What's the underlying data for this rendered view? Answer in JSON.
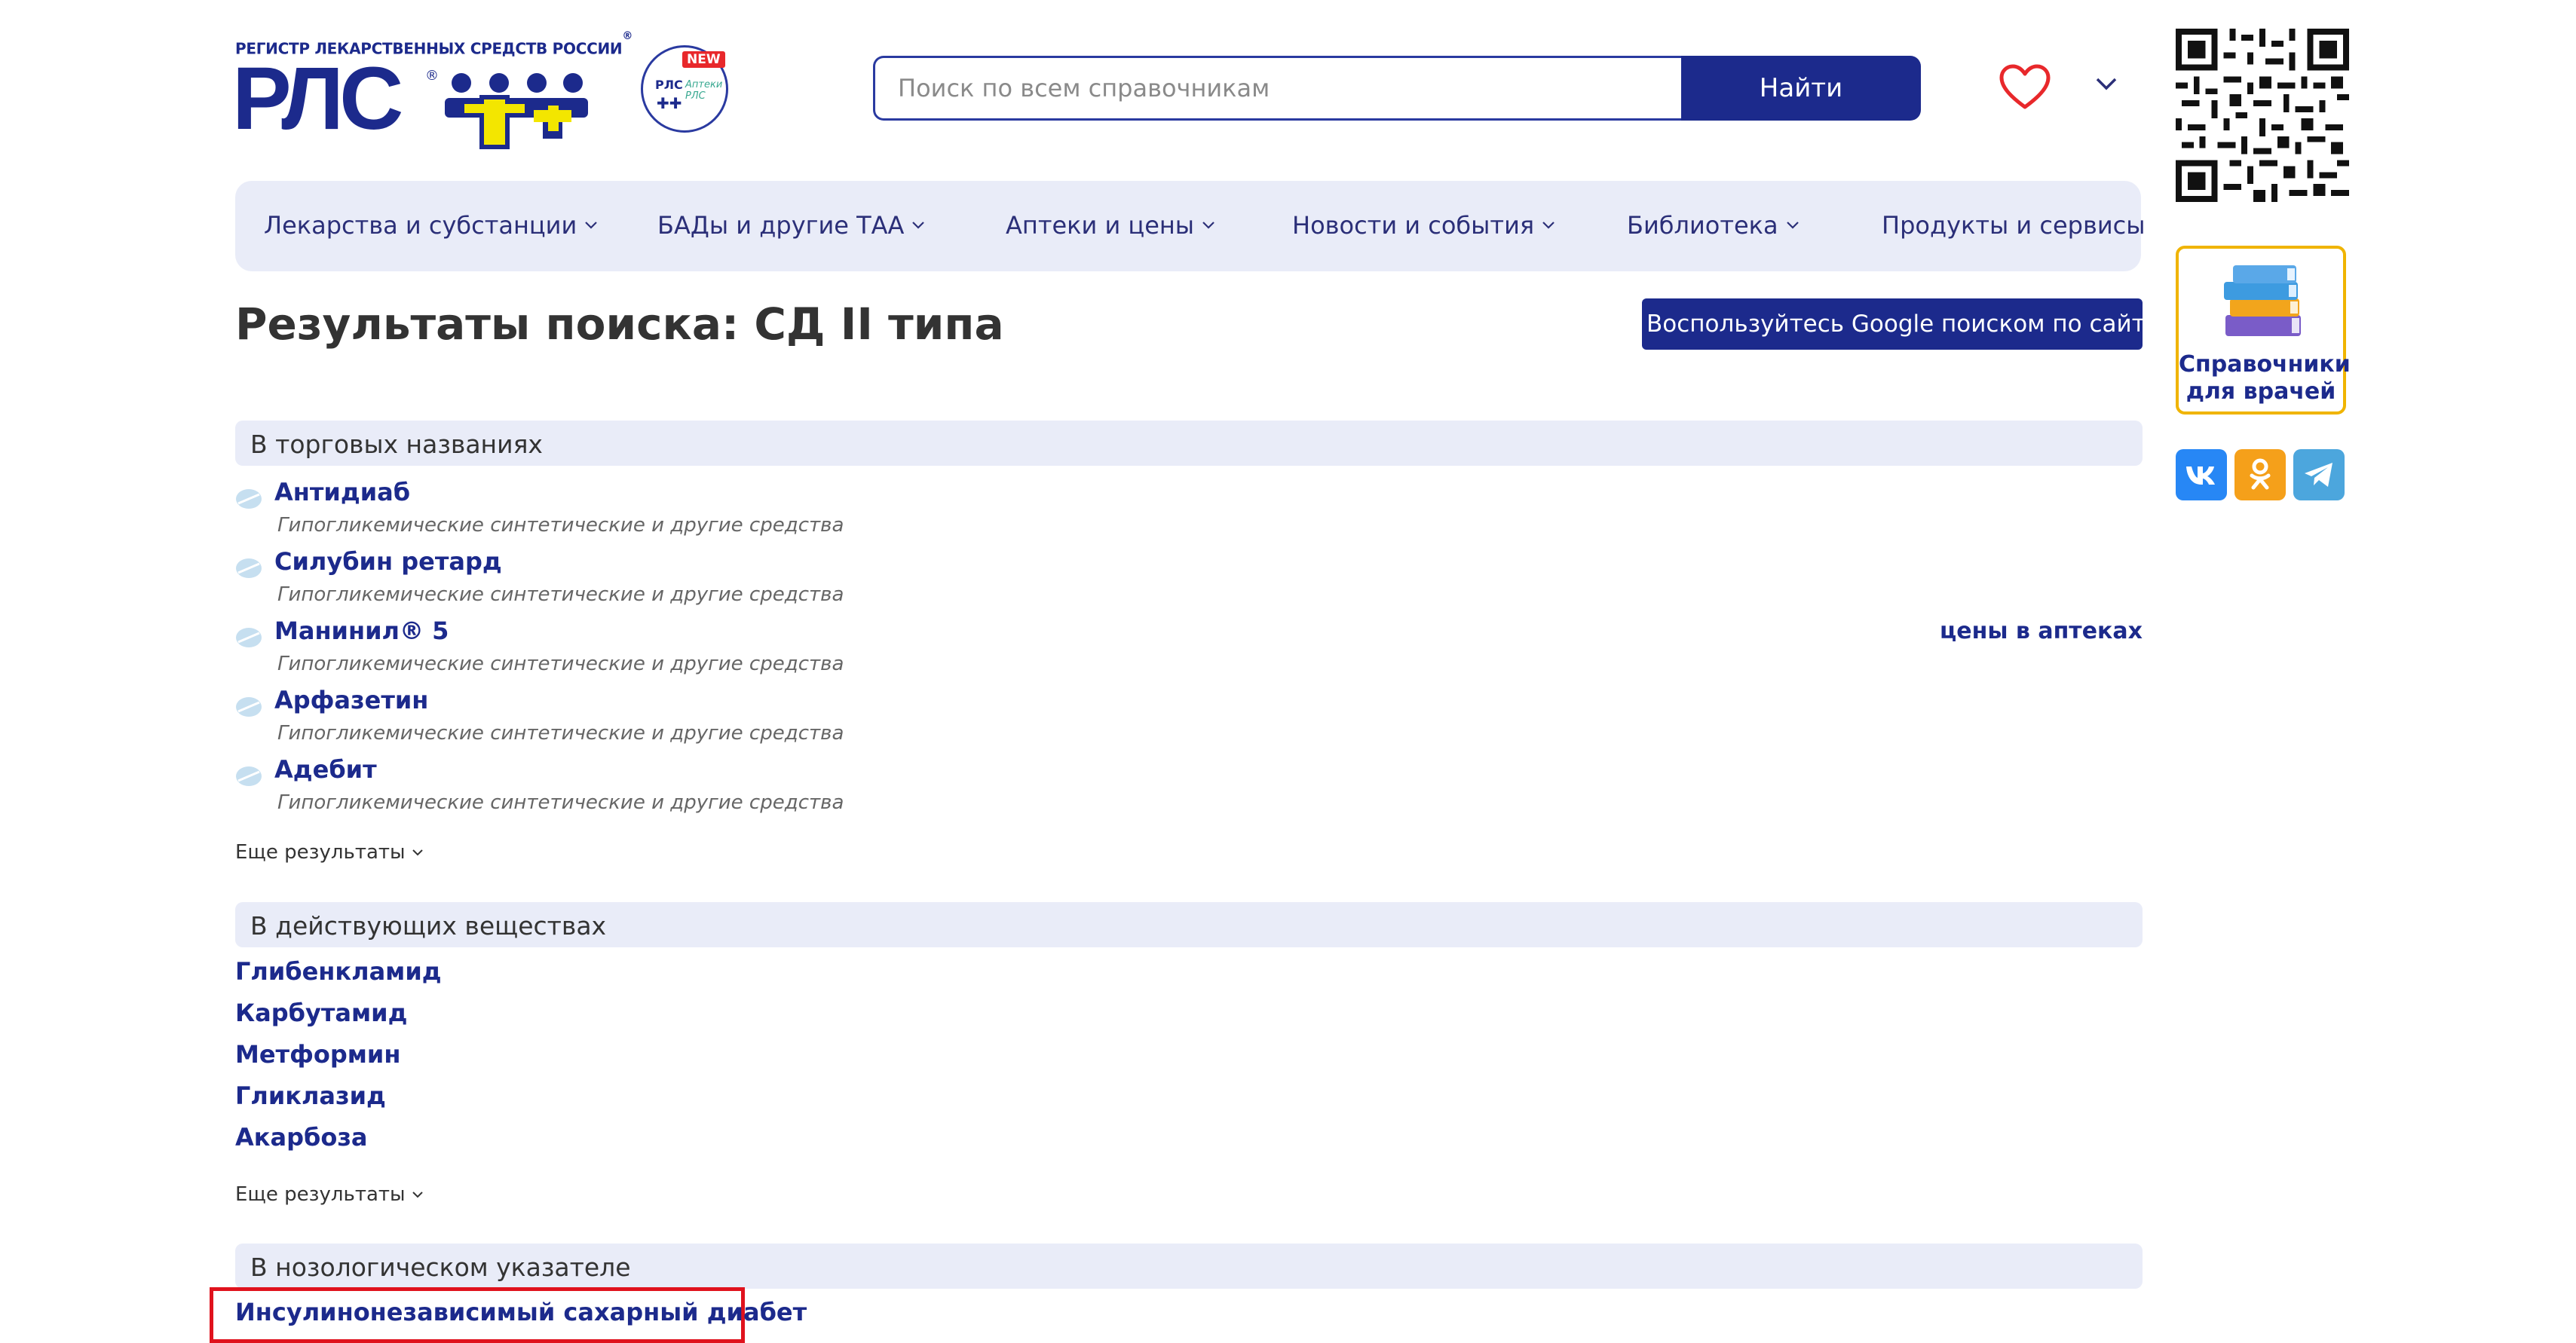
{
  "header": {
    "logo_tagline": "РЕГИСТР ЛЕКАРСТВЕННЫХ СРЕДСТВ РОССИИ",
    "logo_tagline_mark": "®",
    "logo_text": "РЛС",
    "logo_mark_reg": "®",
    "app_badge": {
      "new": "NEW",
      "brand": "РЛС",
      "brand_plus": "✚✚",
      "subtitle": "Аптеки РЛС"
    },
    "search": {
      "placeholder": "Поиск по всем справочникам",
      "value": "",
      "button_label": "Найти"
    }
  },
  "nav": {
    "items": [
      {
        "label": "Лекарства и субстанции",
        "has_dropdown": true
      },
      {
        "label": "БАДы и другие ТАА",
        "has_dropdown": true
      },
      {
        "label": "Аптеки и цены",
        "has_dropdown": true
      },
      {
        "label": "Новости и события",
        "has_dropdown": true
      },
      {
        "label": "Библиотека",
        "has_dropdown": true
      },
      {
        "label": "Продукты и сервисы",
        "has_dropdown": false
      }
    ]
  },
  "sidebar": {
    "books_label_1": "Справочники",
    "books_label_2": "для врачей",
    "social": {
      "vk": "VK",
      "ok": "OK",
      "tg": "Telegram"
    }
  },
  "main": {
    "title": "Результаты поиска: СД II типа",
    "google_button": "Воспользуйтесь Google поиском по сайту",
    "trade_names": {
      "heading": "В торговых названиях",
      "items": [
        {
          "name": "Антидиаб",
          "class": "Гипогликемические синтетические и другие средства",
          "price_link": ""
        },
        {
          "name": "Силубин ретард",
          "class": "Гипогликемические синтетические и другие средства",
          "price_link": ""
        },
        {
          "name": "Манинил® 5",
          "class": "Гипогликемические синтетические и другие средства",
          "price_link": "цены в аптеках"
        },
        {
          "name": "Арфазетин",
          "class": "Гипогликемические синтетические и другие средства",
          "price_link": ""
        },
        {
          "name": "Адебит",
          "class": "Гипогликемические синтетические и другие средства",
          "price_link": ""
        }
      ],
      "more": "Еще результаты"
    },
    "substances": {
      "heading": "В действующих веществах",
      "items": [
        "Глибенкламид",
        "Карбутамид",
        "Метформин",
        "Гликлазид",
        "Акарбоза"
      ],
      "more": "Еще результаты"
    },
    "nosology": {
      "heading": "В нозологическом указателе",
      "items": [
        "Инсулинонезависимый сахарный диабет"
      ]
    }
  },
  "colors": {
    "brand_blue": "#1c2a8c",
    "nav_bg": "#e9ecf8",
    "heart_red": "#e8282b",
    "highlight_red": "#e0121d",
    "books_border": "#f0b400"
  }
}
